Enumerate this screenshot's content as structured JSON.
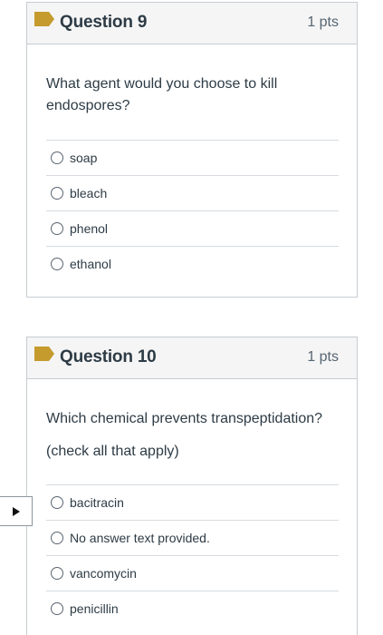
{
  "questions": [
    {
      "title": "Question 9",
      "points": "1 pts",
      "text": "What agent would you choose to kill endospores?",
      "answers": [
        "soap",
        "bleach",
        "phenol",
        "ethanol"
      ]
    },
    {
      "title": "Question 10",
      "points": "1 pts",
      "text": "Which chemical prevents transpeptidation?",
      "subtext": "(check all that apply)",
      "answers": [
        "bacitracin",
        "No answer text provided.",
        "vancomycin",
        "penicillin"
      ]
    }
  ],
  "icons": {
    "flag": "bookmark-flag-icon",
    "nav": "play-triangle-icon"
  },
  "colors": {
    "flag": "#c49b2c",
    "header_bg": "#f5f5f5",
    "border": "#c7cdd1"
  }
}
